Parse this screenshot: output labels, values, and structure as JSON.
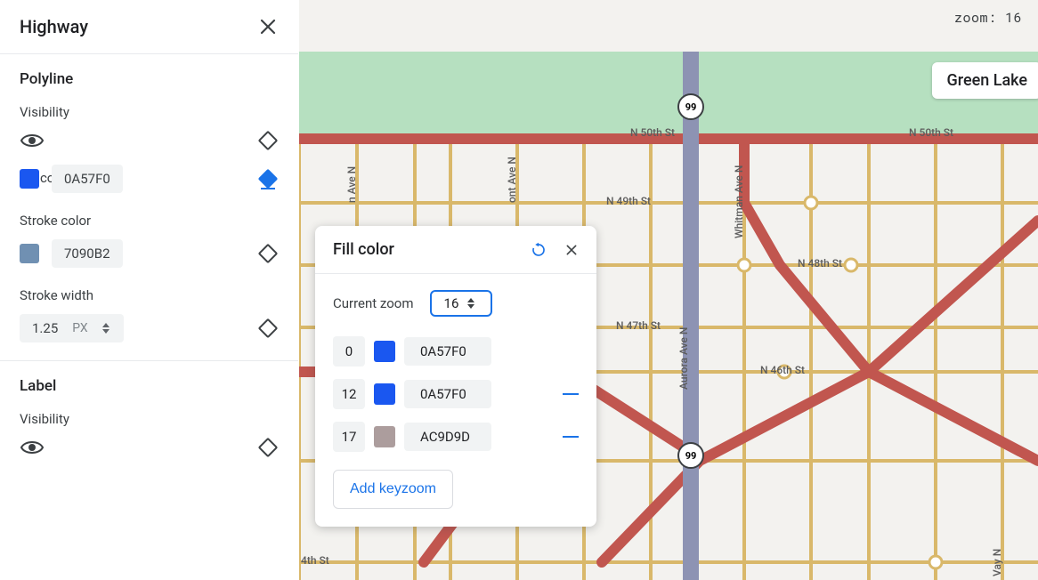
{
  "sidebar": {
    "title": "Highway",
    "sections": {
      "polyline": {
        "title": "Polyline",
        "visibility_label": "Visibility",
        "fill_color": {
          "label": "Fill color",
          "swatch": "#1a57f0",
          "hex": "0A57F0"
        },
        "stroke_color": {
          "label": "Stroke color",
          "swatch": "#7090b2",
          "hex": "7090B2"
        },
        "stroke_width": {
          "label": "Stroke width",
          "value": "1.25",
          "unit": "PX"
        }
      },
      "label": {
        "title": "Label",
        "visibility_label": "Visibility"
      }
    }
  },
  "main": {
    "zoom_prefix": "zoom:",
    "zoom_value": "16",
    "place_label": "Green Lake",
    "streets": {
      "n50": "N 50th St",
      "n50_b": "N 50th St",
      "n49": "N 49th St",
      "n48": "N 48th St",
      "n47": "N 47th St",
      "n46": "N 46th St",
      "th": "4th St",
      "whitman": "Whitman Ave N",
      "aurora": "Aurora Ave N",
      "mont": "ont Ave N",
      "n_ave_n": "n Ave N",
      "way_n": "Vay N"
    },
    "shields": {
      "hw99": "99",
      "hw99b": "99"
    }
  },
  "popover": {
    "title": "Fill color",
    "current_zoom_label": "Current zoom",
    "current_zoom_value": "16",
    "keyzooms": [
      {
        "zoom": "0",
        "swatch": "#1a57f0",
        "hex": "0A57F0",
        "removable": false
      },
      {
        "zoom": "12",
        "swatch": "#1a57f0",
        "hex": "0A57F0",
        "removable": true
      },
      {
        "zoom": "17",
        "swatch": "#ac9d9d",
        "hex": "AC9D9D",
        "removable": true
      }
    ],
    "add_label": "Add keyzoom"
  }
}
